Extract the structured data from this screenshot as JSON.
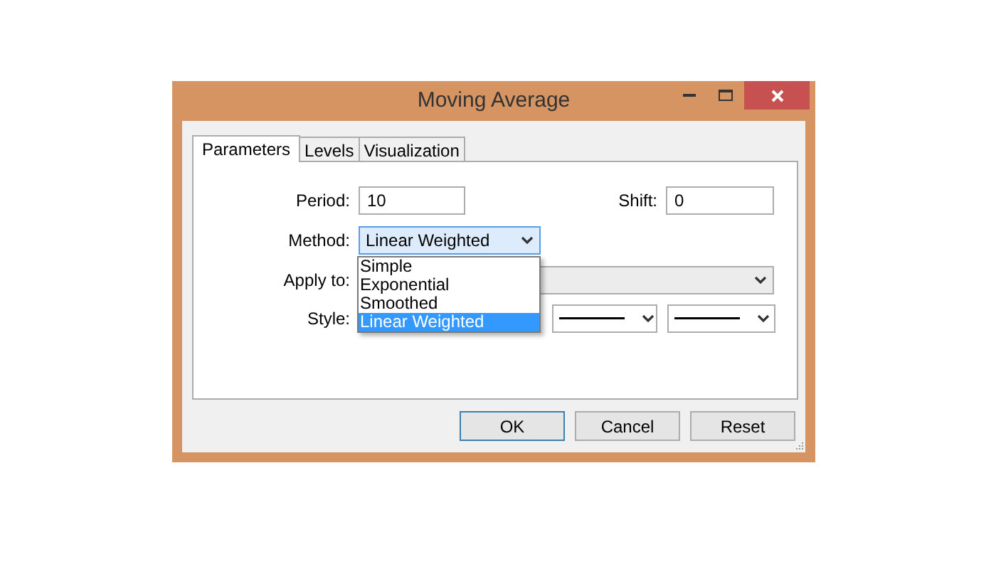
{
  "window": {
    "title": "Moving Average"
  },
  "tabs": [
    {
      "label": "Parameters",
      "selected": true
    },
    {
      "label": "Levels",
      "selected": false
    },
    {
      "label": "Visualization",
      "selected": false
    }
  ],
  "period": {
    "label": "Period:",
    "value": "10"
  },
  "shift": {
    "label": "Shift:",
    "value": "0"
  },
  "method": {
    "label": "Method:",
    "value": "Linear Weighted",
    "expanded": true,
    "options": [
      {
        "label": "Simple",
        "selected": false
      },
      {
        "label": "Exponential",
        "selected": false
      },
      {
        "label": "Smoothed",
        "selected": false
      },
      {
        "label": "Linear Weighted",
        "selected": true
      }
    ]
  },
  "apply_to": {
    "label": "Apply to:"
  },
  "style": {
    "label": "Style:"
  },
  "buttons": [
    {
      "label": "OK",
      "selected": true
    },
    {
      "label": "Cancel",
      "selected": false
    },
    {
      "label": "Reset",
      "selected": false
    }
  ]
}
